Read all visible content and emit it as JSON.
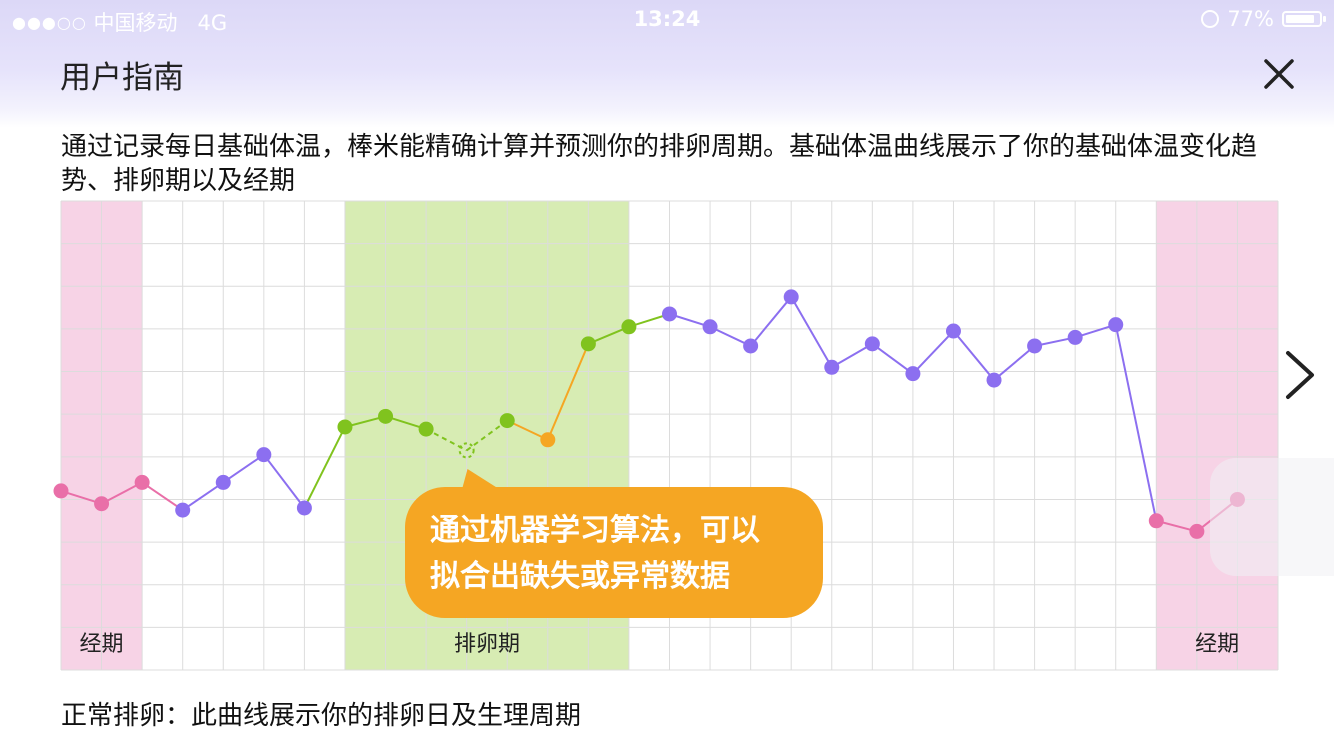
{
  "status_bar": {
    "signal": "●●●○○",
    "carrier": "中国移动",
    "network": "4G",
    "time": "13:24",
    "battery": "77%"
  },
  "header": {
    "title": "用户指南"
  },
  "description": "通过记录每日基础体温，棒米能精确计算并预测你的排卵周期。基础体温曲线展示了你的基础体温变化趋势、排卵期以及经期",
  "callout": {
    "line1": "通过机器学习算法，可以",
    "line2": "拟合出缺失或异常数据"
  },
  "footer": {
    "caption": "正常排卵：此曲线展示你的排卵日及生理周期"
  },
  "colors": {
    "period_band": "#f7d3e6",
    "ovulation_band": "#d7ecb3",
    "period_point": "#e96fa8",
    "normal_point": "#8c6ff0",
    "ovulation_point": "#80c31e",
    "fitted_point": "#f5a623",
    "callout_bg": "#f5a623"
  },
  "chart_data": {
    "type": "line",
    "bands": [
      {
        "label": "经期",
        "from": 1,
        "to": 2,
        "kind": "period"
      },
      {
        "label": "排卵期",
        "from": 8,
        "to": 14,
        "kind": "ovulation"
      },
      {
        "label": "经期",
        "from": 28,
        "to": 30,
        "kind": "period"
      }
    ],
    "x": [
      1,
      2,
      3,
      4,
      5,
      6,
      7,
      8,
      9,
      10,
      11,
      12,
      13,
      14,
      15,
      16,
      17,
      18,
      19,
      20,
      21,
      22,
      23,
      24,
      25,
      26,
      27,
      28,
      29,
      30
    ],
    "values": [
      4.2,
      3.9,
      4.4,
      3.75,
      4.4,
      5.05,
      3.8,
      5.7,
      5.95,
      5.65,
      5.15,
      5.85,
      5.4,
      7.65,
      8.05,
      8.35,
      8.05,
      7.6,
      8.75,
      7.1,
      7.65,
      6.95,
      7.95,
      6.8,
      7.6,
      7.8,
      8.1,
      3.5,
      3.25,
      4.0
    ],
    "point_types": [
      "period",
      "period",
      "period",
      "normal",
      "normal",
      "normal",
      "normal",
      "ovulation",
      "ovulation",
      "ovulation",
      "missing",
      "ovulation",
      "abnormal",
      "ovulation",
      "ovulation",
      "normal",
      "normal",
      "normal",
      "normal",
      "normal",
      "normal",
      "normal",
      "normal",
      "normal",
      "normal",
      "normal",
      "normal",
      "period",
      "period",
      "period"
    ],
    "ylim": [
      0,
      11
    ],
    "grid": true
  }
}
